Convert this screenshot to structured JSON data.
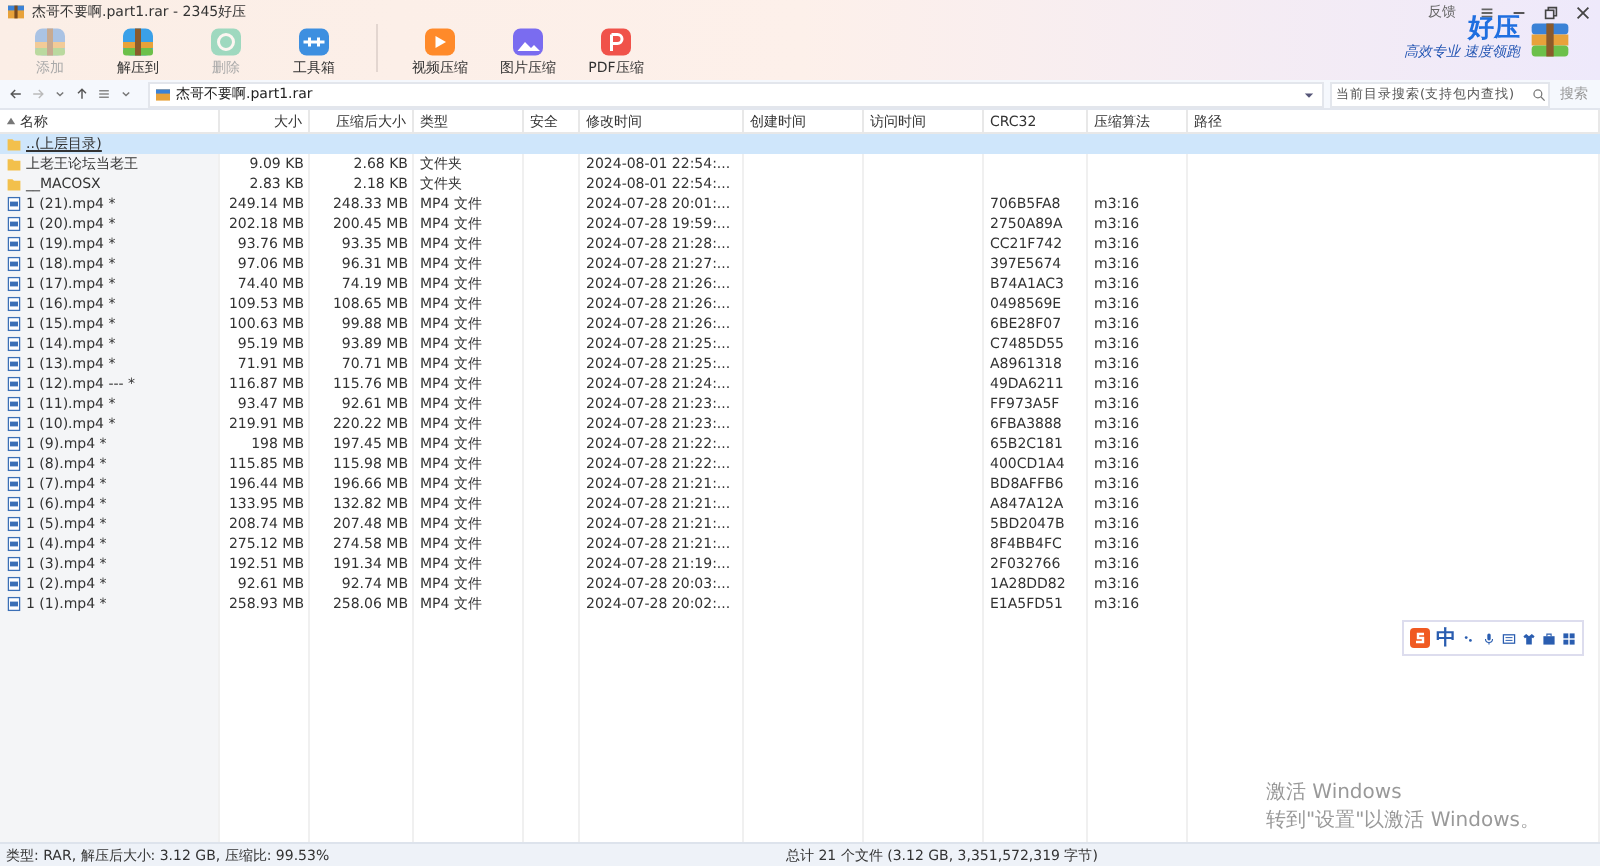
{
  "window": {
    "title": "杰哥不要啊.part1.rar - 2345好压",
    "feedback": "反馈"
  },
  "toolbar": [
    {
      "kind": "add",
      "label": "添加",
      "disabled": true
    },
    {
      "kind": "extract",
      "label": "解压到",
      "disabled": false
    },
    {
      "kind": "delete",
      "label": "删除",
      "disabled": true
    },
    {
      "kind": "toolbox",
      "label": "工具箱",
      "disabled": false
    },
    {
      "kind": "video",
      "label": "视频压缩",
      "disabled": false
    },
    {
      "kind": "image",
      "label": "图片压缩",
      "disabled": false
    },
    {
      "kind": "pdf",
      "label": "PDF压缩",
      "disabled": false
    }
  ],
  "brand": {
    "name": "好压",
    "slogan": "高效专业 速度领跑"
  },
  "address": {
    "path": "杰哥不要啊.part1.rar"
  },
  "search": {
    "placeholder": "当前目录搜索(支持包内查找)",
    "button": "搜索"
  },
  "table": {
    "columns": [
      "名称",
      "大小",
      "压缩后大小",
      "类型",
      "安全",
      "修改时间",
      "创建时间",
      "访问时间",
      "CRC32",
      "压缩算法",
      "路径"
    ],
    "rows": [
      {
        "kind": "parent",
        "name": "..(上层目录)",
        "selected": true
      },
      {
        "kind": "folder",
        "name": "上老王论坛当老王",
        "size": "9.09 KB",
        "packed": "2.68 KB",
        "type": "文件夹",
        "modified": "2024-08-01 22:54:...",
        "selected": false
      },
      {
        "kind": "folder",
        "name": "__MACOSX",
        "size": "2.83 KB",
        "packed": "2.18 KB",
        "type": "文件夹",
        "modified": "2024-08-01 22:54:...",
        "selected": false
      },
      {
        "kind": "file",
        "name": "1 (21).mp4 *",
        "size": "249.14 MB",
        "packed": "248.33 MB",
        "type": "MP4 文件",
        "modified": "2024-07-28 20:01:...",
        "crc": "706B5FA8",
        "method": "m3:16",
        "selected": false
      },
      {
        "kind": "file",
        "name": "1 (20).mp4 *",
        "size": "202.18 MB",
        "packed": "200.45 MB",
        "type": "MP4 文件",
        "modified": "2024-07-28 19:59:...",
        "crc": "2750A89A",
        "method": "m3:16",
        "selected": false
      },
      {
        "kind": "file",
        "name": "1 (19).mp4 *",
        "size": "93.76 MB",
        "packed": "93.35 MB",
        "type": "MP4 文件",
        "modified": "2024-07-28 21:28:...",
        "crc": "CC21F742",
        "method": "m3:16",
        "selected": false
      },
      {
        "kind": "file",
        "name": "1 (18).mp4 *",
        "size": "97.06 MB",
        "packed": "96.31 MB",
        "type": "MP4 文件",
        "modified": "2024-07-28 21:27:...",
        "crc": "397E5674",
        "method": "m3:16",
        "selected": false
      },
      {
        "kind": "file",
        "name": "1 (17).mp4 *",
        "size": "74.40 MB",
        "packed": "74.19 MB",
        "type": "MP4 文件",
        "modified": "2024-07-28 21:26:...",
        "crc": "B74A1AC3",
        "method": "m3:16",
        "selected": false
      },
      {
        "kind": "file",
        "name": "1 (16).mp4 *",
        "size": "109.53 MB",
        "packed": "108.65 MB",
        "type": "MP4 文件",
        "modified": "2024-07-28 21:26:...",
        "crc": "0498569E",
        "method": "m3:16",
        "selected": false
      },
      {
        "kind": "file",
        "name": "1 (15).mp4 *",
        "size": "100.63 MB",
        "packed": "99.88 MB",
        "type": "MP4 文件",
        "modified": "2024-07-28 21:26:...",
        "crc": "6BE28F07",
        "method": "m3:16",
        "selected": false
      },
      {
        "kind": "file",
        "name": "1 (14).mp4 *",
        "size": "95.19 MB",
        "packed": "93.89 MB",
        "type": "MP4 文件",
        "modified": "2024-07-28 21:25:...",
        "crc": "C7485D55",
        "method": "m3:16",
        "selected": false
      },
      {
        "kind": "file",
        "name": "1 (13).mp4 *",
        "size": "71.91 MB",
        "packed": "70.71 MB",
        "type": "MP4 文件",
        "modified": "2024-07-28 21:25:...",
        "crc": "A8961318",
        "method": "m3:16",
        "selected": false
      },
      {
        "kind": "file",
        "name": "1 (12).mp4 --- *",
        "size": "116.87 MB",
        "packed": "115.76 MB",
        "type": "MP4 文件",
        "modified": "2024-07-28 21:24:...",
        "crc": "49DA6211",
        "method": "m3:16",
        "selected": false
      },
      {
        "kind": "file",
        "name": "1 (11).mp4 *",
        "size": "93.47 MB",
        "packed": "92.61 MB",
        "type": "MP4 文件",
        "modified": "2024-07-28 21:23:...",
        "crc": "FF973A5F",
        "method": "m3:16",
        "selected": false
      },
      {
        "kind": "file",
        "name": "1 (10).mp4 *",
        "size": "219.91 MB",
        "packed": "220.22 MB",
        "type": "MP4 文件",
        "modified": "2024-07-28 21:23:...",
        "crc": "6FBA3888",
        "method": "m3:16",
        "selected": false
      },
      {
        "kind": "file",
        "name": "1 (9).mp4 *",
        "size": "198 MB",
        "packed": "197.45 MB",
        "type": "MP4 文件",
        "modified": "2024-07-28 21:22:...",
        "crc": "65B2C181",
        "method": "m3:16",
        "selected": false
      },
      {
        "kind": "file",
        "name": "1 (8).mp4 *",
        "size": "115.85 MB",
        "packed": "115.98 MB",
        "type": "MP4 文件",
        "modified": "2024-07-28 21:22:...",
        "crc": "400CD1A4",
        "method": "m3:16",
        "selected": false
      },
      {
        "kind": "file",
        "name": "1 (7).mp4 *",
        "size": "196.44 MB",
        "packed": "196.66 MB",
        "type": "MP4 文件",
        "modified": "2024-07-28 21:21:...",
        "crc": "BD8AFFB6",
        "method": "m3:16",
        "selected": false
      },
      {
        "kind": "file",
        "name": "1 (6).mp4 *",
        "size": "133.95 MB",
        "packed": "132.82 MB",
        "type": "MP4 文件",
        "modified": "2024-07-28 21:21:...",
        "crc": "A847A12A",
        "method": "m3:16",
        "selected": false
      },
      {
        "kind": "file",
        "name": "1 (5).mp4 *",
        "size": "208.74 MB",
        "packed": "207.48 MB",
        "type": "MP4 文件",
        "modified": "2024-07-28 21:21:...",
        "crc": "5BD2047B",
        "method": "m3:16",
        "selected": false
      },
      {
        "kind": "file",
        "name": "1 (4).mp4 *",
        "size": "275.12 MB",
        "packed": "274.58 MB",
        "type": "MP4 文件",
        "modified": "2024-07-28 21:21:...",
        "crc": "8F4BB4FC",
        "method": "m3:16",
        "selected": false
      },
      {
        "kind": "file",
        "name": "1 (3).mp4 *",
        "size": "192.51 MB",
        "packed": "191.34 MB",
        "type": "MP4 文件",
        "modified": "2024-07-28 21:19:...",
        "crc": "2F032766",
        "method": "m3:16",
        "selected": false
      },
      {
        "kind": "file",
        "name": "1 (2).mp4 *",
        "size": "92.61 MB",
        "packed": "92.74 MB",
        "type": "MP4 文件",
        "modified": "2024-07-28 20:03:...",
        "crc": "1A28DD82",
        "method": "m3:16",
        "selected": false
      },
      {
        "kind": "file",
        "name": "1 (1).mp4 *",
        "size": "258.93 MB",
        "packed": "258.06 MB",
        "type": "MP4 文件",
        "modified": "2024-07-28 20:02:...",
        "crc": "E1A5FD51",
        "method": "m3:16",
        "selected": false
      }
    ]
  },
  "ime": {
    "mode": "中"
  },
  "activation": {
    "title": "激活 Windows",
    "hint": "转到\"设置\"以激活 Windows。"
  },
  "status_bar": {
    "left": "类型: RAR, 解压后大小: 3.12 GB, 压缩比: 99.53%",
    "center": "总计 21 个文件 (3.12 GB, 3,351,572,319 字节)"
  }
}
